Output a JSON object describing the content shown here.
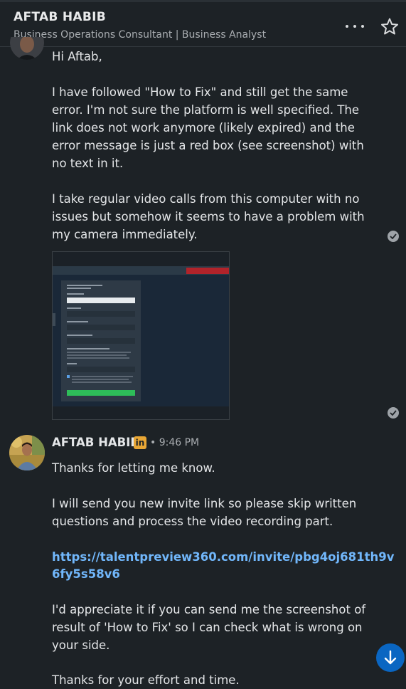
{
  "header": {
    "name": "AFTAB HABIB",
    "subtitle": "Business Operations Consultant | Business Analyst"
  },
  "messages": [
    {
      "lines": [
        "Hi Aftab,",
        "I have followed \"How to Fix\" and still get the same",
        "error. I'm not sure the platform is well specified. The",
        "link does not work anymore (likely expired) and the",
        "error message is just a red box (see screenshot) with",
        "no text in it.",
        "I take regular video calls from this computer with no",
        "issues but somehow it seems to have a problem with",
        "my camera immediately."
      ]
    },
    {
      "sender": "AFTAB HABIB",
      "badge": "in",
      "time": "• 9:46 PM",
      "lines": [
        "Thanks for letting me know.",
        "I will send you new invite link so please skip written",
        "questions and process the video recording part.",
        "https://talentpreview360.com/invite/pbg4oj681th9v",
        "6fy5s58v6",
        "I'd appreciate it if you can send me the screenshot of",
        "result of 'How to Fix' so I can check what is wrong on",
        "your side.",
        "Thanks for your effort and time."
      ]
    }
  ],
  "colors": {
    "background": "#1d2226",
    "text": "#e4e6e8",
    "link": "#71b7fb",
    "linkedin_badge": "#e8a635",
    "fab": "#0a66c2"
  },
  "icons": {
    "more": "more-horizontal-icon",
    "star": "star-outline-icon",
    "read": "check-circle-icon",
    "scroll": "arrow-down-icon"
  }
}
